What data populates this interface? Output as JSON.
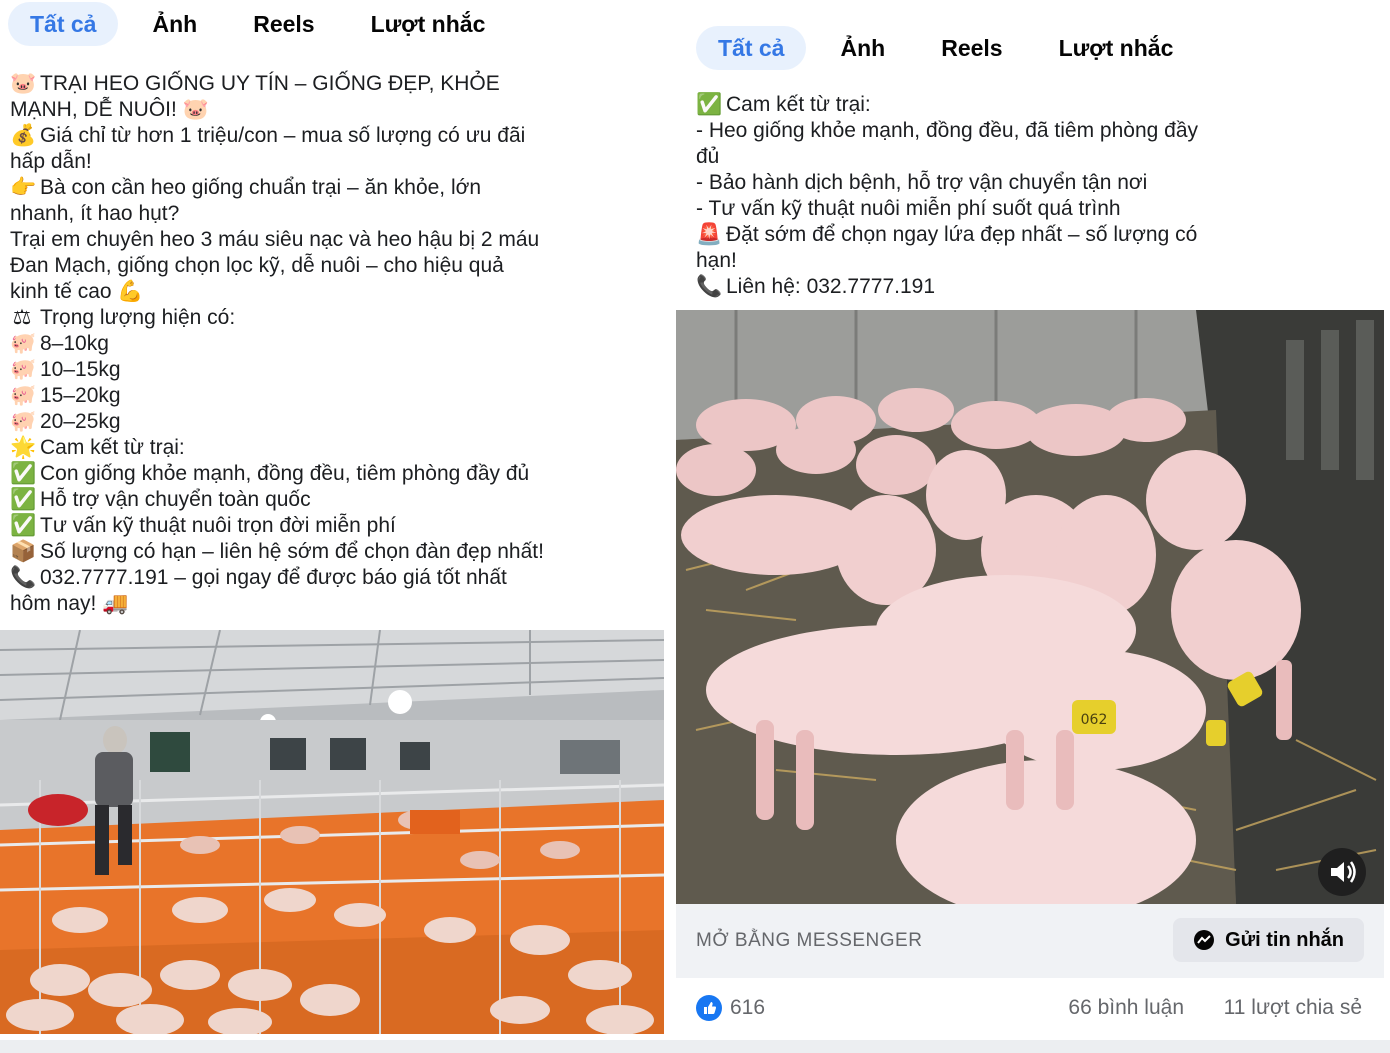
{
  "left_post": {
    "tabs": [
      "Tất cả",
      "Ảnh",
      "Reels",
      "Lượt nhắc"
    ],
    "lines": [
      {
        "icon": "pig-face-icon",
        "glyph": "🐷",
        "text": "TRẠI HEO GIỐNG UY TÍN – GIỐNG ĐẸP, KHỎE"
      },
      {
        "icon": "",
        "glyph": "",
        "text": "MẠNH, DỄ NUÔI! 🐷"
      },
      {
        "icon": "money-bag-icon",
        "glyph": "💰",
        "text": "Giá chỉ từ hơn 1 triệu/con – mua số lượng có ưu đãi"
      },
      {
        "icon": "",
        "glyph": "",
        "text": "hấp dẫn!"
      },
      {
        "icon": "pointing-hand-icon",
        "glyph": "👉",
        "text": "Bà con cần heo giống chuẩn trại – ăn khỏe, lớn"
      },
      {
        "icon": "",
        "glyph": "",
        "text": "nhanh, ít hao hụt?"
      },
      {
        "icon": "",
        "glyph": "",
        "text": "Trại em chuyên heo 3 máu siêu nạc và heo hậu bị 2 máu"
      },
      {
        "icon": "",
        "glyph": "",
        "text": "Đan Mạch, giống chọn lọc kỹ, dễ nuôi – cho hiệu quả"
      },
      {
        "icon": "",
        "glyph": "",
        "text": "kinh tế cao 💪"
      },
      {
        "icon": "scale-icon",
        "glyph": "⚖",
        "text": "Trọng lượng hiện có:"
      },
      {
        "icon": "pig-icon",
        "glyph": "🐖",
        "text": "8–10kg"
      },
      {
        "icon": "pig-icon",
        "glyph": "🐖",
        "text": "10–15kg"
      },
      {
        "icon": "pig-icon",
        "glyph": "🐖",
        "text": "15–20kg"
      },
      {
        "icon": "pig-icon",
        "glyph": "🐖",
        "text": "20–25kg"
      },
      {
        "icon": "star-icon",
        "glyph": "🌟",
        "text": "Cam kết từ trại:"
      },
      {
        "icon": "check-icon",
        "glyph": "✅",
        "text": "Con giống khỏe mạnh, đồng đều, tiêm phòng đầy đủ"
      },
      {
        "icon": "check-icon",
        "glyph": "✅",
        "text": "Hỗ trợ vận chuyển toàn quốc"
      },
      {
        "icon": "check-icon",
        "glyph": "✅",
        "text": "Tư vấn kỹ thuật nuôi trọn đời miễn phí"
      },
      {
        "icon": "package-icon",
        "glyph": "📦",
        "text": "Số lượng có hạn – liên hệ sớm để chọn đàn đẹp nhất!"
      },
      {
        "icon": "phone-icon",
        "glyph": "📞",
        "text": "032.7777.191 – gọi ngay để được báo giá tốt nhất"
      },
      {
        "icon": "",
        "glyph": "",
        "text": "hôm nay! 🚚"
      }
    ]
  },
  "right_post": {
    "tabs": [
      "Tất cả",
      "Ảnh",
      "Reels",
      "Lượt nhắc"
    ],
    "lines": [
      {
        "icon": "check-icon",
        "glyph": "✅",
        "text": "Cam kết từ trại:"
      },
      {
        "icon": "",
        "glyph": "",
        "text": "- Heo giống khỏe mạnh, đồng đều, đã tiêm phòng đầy"
      },
      {
        "icon": "",
        "glyph": "",
        "text": "đủ"
      },
      {
        "icon": "",
        "glyph": "",
        "text": "- Bảo hành dịch bệnh, hỗ trợ vận chuyển tận nơi"
      },
      {
        "icon": "",
        "glyph": "",
        "text": "- Tư vấn kỹ thuật nuôi miễn phí suốt quá trình"
      },
      {
        "icon": "alert-icon",
        "glyph": "🚨",
        "text": "Đặt sớm để chọn ngay lứa đẹp nhất – số lượng có"
      },
      {
        "icon": "",
        "glyph": "",
        "text": "hạn!"
      },
      {
        "icon": "phone-icon",
        "glyph": "📞",
        "text": "Liên hệ: 032.7777.191"
      }
    ],
    "messenger_label": "MỞ BẰNG MESSENGER",
    "send_button": "Gửi tin nhắn",
    "likes": "616",
    "comments": "66 bình luận",
    "shares": "11 lượt chia sẻ",
    "ear_tag": "062"
  },
  "colors": {
    "tab_active_bg": "#e8f1fd",
    "tab_active_text": "#3578e5",
    "like_blue": "#1877f2",
    "barn_floor": "#e8742a",
    "pig_pink": "#f2c9c9"
  }
}
